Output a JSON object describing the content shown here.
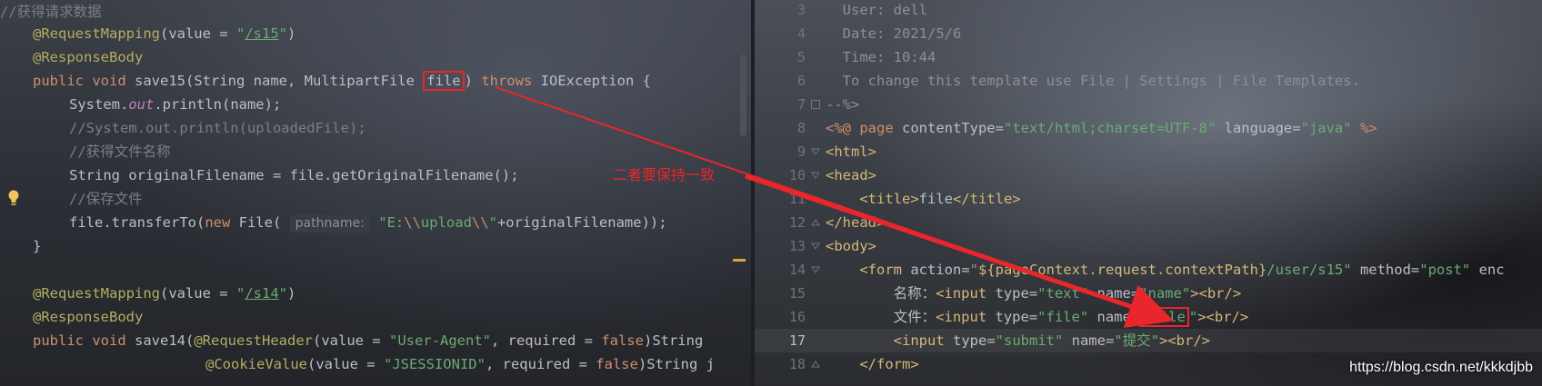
{
  "left_editor": {
    "lines": [
      {
        "type": "comment_top",
        "text": "//获得请求数据"
      },
      {
        "type": "mapping",
        "annotation": "@RequestMapping",
        "open": "(value = ",
        "path": "/s15",
        "close": ")"
      },
      {
        "type": "plain_ann",
        "annotation": "@ResponseBody"
      },
      {
        "type": "sig15",
        "kw1": "public",
        "kw2": "void",
        "method": "save15(String name, MultipartFile ",
        "param": "file",
        "paren": ")",
        "kw3": "throws",
        "rest": "IOException {"
      },
      {
        "type": "println",
        "a": "System.",
        "b": "out",
        "c": ".println(name);"
      },
      {
        "type": "comment",
        "text": "//System.out.println(uploadedFile);"
      },
      {
        "type": "comment",
        "text": "//获得文件名称"
      },
      {
        "type": "plain",
        "text": "String originalFilename = file.getOriginalFilename();"
      },
      {
        "type": "comment",
        "text": "//保存文件"
      },
      {
        "type": "transfer",
        "a": "file.transferTo(",
        "kw": "new",
        "b": " File(",
        "hint": "pathname:",
        "s1": "\"E:",
        "e1": "\\\\",
        "s2": "upload",
        "e2": "\\\\",
        "s3": "\"",
        "c": "+originalFilename));"
      },
      {
        "type": "plain",
        "text": "}"
      },
      {
        "type": "blank",
        "text": ""
      },
      {
        "type": "mapping",
        "annotation": "@RequestMapping",
        "open": "(value = ",
        "path": "/s14",
        "close": ")"
      },
      {
        "type": "plain_ann",
        "annotation": "@ResponseBody"
      },
      {
        "type": "sig14",
        "kw1": "public",
        "kw2": "void",
        "method": "save14(",
        "ann": "@RequestHeader",
        "a": "(value = ",
        "s": "\"User-Agent\"",
        "b": ", required = ",
        "f": "false",
        "c": ")String"
      },
      {
        "type": "cookie",
        "ann": "@CookieValue",
        "a": "(value = ",
        "s": "\"JSESSIONID\"",
        "b": ", required = ",
        "f": "false",
        "c": ")String j"
      }
    ]
  },
  "annotation_note": "二者要保持一致",
  "right_editor": {
    "line_numbers": [
      "3",
      "4",
      "5",
      "6",
      "7",
      "8",
      "9",
      "10",
      "11",
      "12",
      "13",
      "14",
      "15",
      "16",
      "17",
      "18"
    ],
    "current_line": "17",
    "lines": [
      "  User: dell",
      "  Date: 2021/5/6",
      "  Time: 10:44",
      "  To change this template use File | Settings | File Templates.",
      "--%>",
      {
        "jsp_open": "<%@ ",
        "page": "page",
        "a1": " contentType=",
        "v1": "\"text/html;charset=UTF-8\"",
        "a2": " language=",
        "v2": "\"java\"",
        "jsp_close": " %>"
      },
      "<html>",
      "<head>",
      {
        "indent": "    ",
        "open": "<title>",
        "text": "file",
        "close": "</title>"
      },
      "</head>",
      "<body>",
      {
        "indent": "    ",
        "form_open": "<form",
        "a1": " action=",
        "v1a": "\"",
        "el": "${pageContext.request.contextPath}",
        "v1b": "/user/s15\"",
        "a2": " method=",
        "v2": "\"post\"",
        "tail": " enc"
      },
      {
        "indent": "        ",
        "label": "名称：",
        "inp": "<input",
        "a1": " type=",
        "v1": "\"text\"",
        "a2": " name=",
        "v2": "\"name\"",
        "close": ">",
        "br": "<br/>"
      },
      {
        "indent": "        ",
        "label": "文件：",
        "inp": "<input",
        "a1": " type=",
        "v1": "\"file\"",
        "a2": " name=",
        "v2q1": "\"",
        "v2": "file",
        "v2q2": "\"",
        "close": ">",
        "br": "<br/>"
      },
      {
        "indent": "        ",
        "inp": "<input",
        "a1": " type=",
        "v1": "\"submit\"",
        "a2": " name=",
        "v2": "\"提交\"",
        "close": ">",
        "br": "<br/>"
      },
      {
        "indent": "    ",
        "close_tag": "</form>"
      }
    ]
  },
  "watermark": "https://blog.csdn.net/kkkdjbb",
  "colors": {
    "annotation_red": "#e8262c",
    "keyword": "#cf8e6d",
    "string": "#6aab73",
    "annotation": "#b3ae60",
    "comment": "#7a7e85"
  }
}
